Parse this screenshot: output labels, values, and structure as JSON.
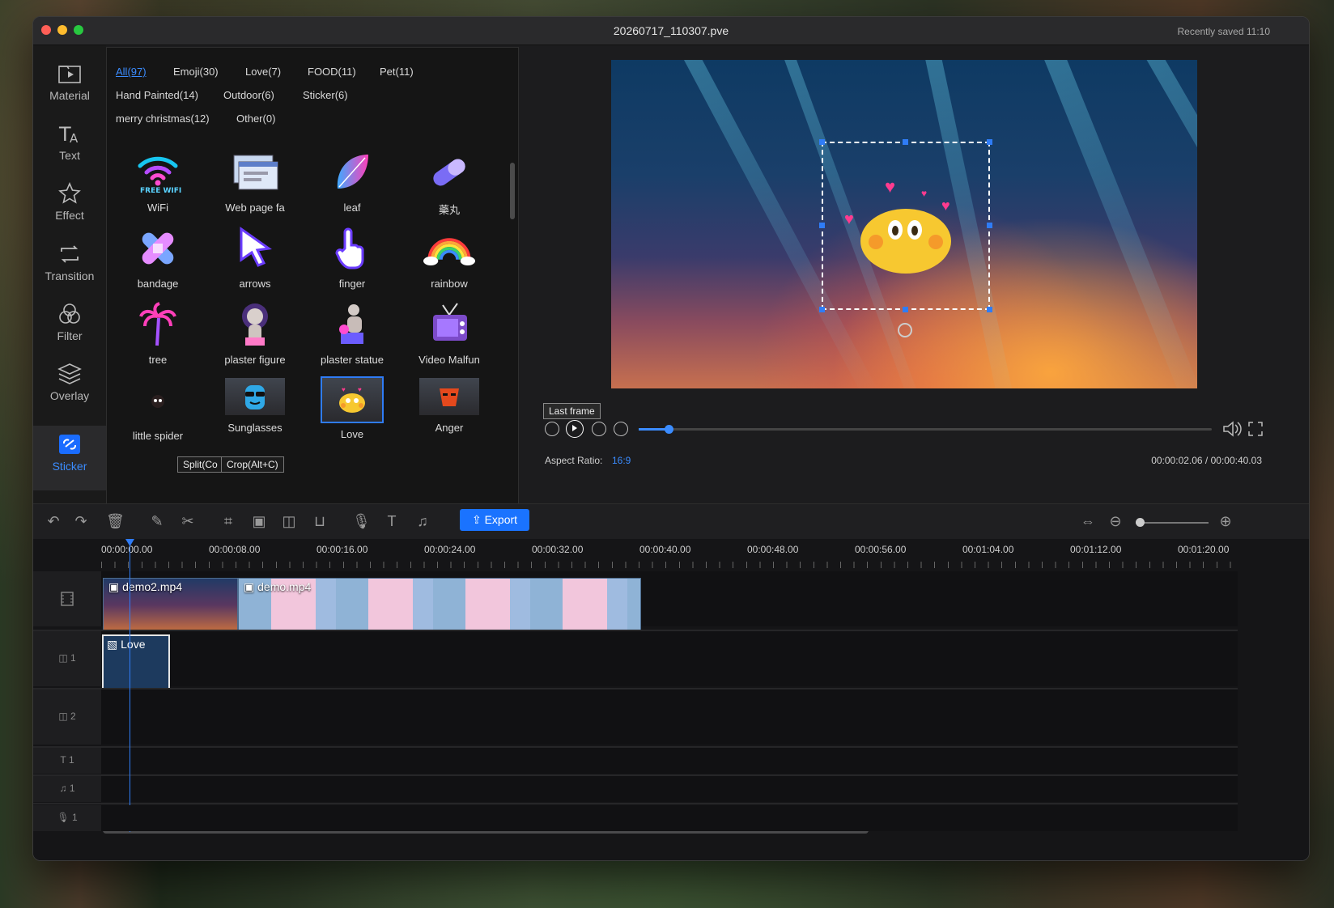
{
  "window": {
    "title": "20260717_110307.pve",
    "saved": "Recently saved  11:10"
  },
  "nav": [
    {
      "label": "Material",
      "icon": "folder-play-icon"
    },
    {
      "label": "Text",
      "icon": "text-icon"
    },
    {
      "label": "Effect",
      "icon": "star-effect-icon"
    },
    {
      "label": "Transition",
      "icon": "transition-icon"
    },
    {
      "label": "Filter",
      "icon": "filter-circles-icon"
    },
    {
      "label": "Overlay",
      "icon": "layers-icon"
    },
    {
      "label": "Sticker",
      "icon": "sticker-icon"
    }
  ],
  "categories": [
    "All(97)",
    "Emoji(30)",
    "Love(7)",
    "FOOD(11)",
    "Pet(11)",
    "Hand Painted(14)",
    "Outdoor(6)",
    "Sticker(6)",
    "merry christmas(12)",
    "Other(0)"
  ],
  "stickers": [
    {
      "label": "WiFi",
      "icon": "wifi-icon"
    },
    {
      "label": "Web page fa",
      "icon": "web-page-icon"
    },
    {
      "label": "leaf",
      "icon": "leaf-icon"
    },
    {
      "label": "藥丸",
      "icon": "pill-icon"
    },
    {
      "label": "bandage",
      "icon": "bandage-icon"
    },
    {
      "label": "arrows",
      "icon": "arrow-cursor-icon"
    },
    {
      "label": "finger",
      "icon": "hand-cursor-icon"
    },
    {
      "label": "rainbow",
      "icon": "rainbow-icon"
    },
    {
      "label": "tree",
      "icon": "palm-tree-icon"
    },
    {
      "label": "plaster figure",
      "icon": "plaster-figure-icon"
    },
    {
      "label": "plaster statue",
      "icon": "plaster-statue-icon"
    },
    {
      "label": "Video Malfun",
      "icon": "tv-icon"
    },
    {
      "label": "little spider",
      "icon": "spider-icon"
    },
    {
      "label": "Sunglasses",
      "icon": "sunglasses-icon"
    },
    {
      "label": "Love",
      "icon": "love-emoji-icon"
    },
    {
      "label": "Anger",
      "icon": "anger-icon"
    }
  ],
  "wifi_caption": "FREE WIFI",
  "tooltip": {
    "split": "Split(Co",
    "crop": "Crop(Alt+C)"
  },
  "preview": {
    "last_frame": "Last frame",
    "aspect_label": "Aspect Ratio:",
    "aspect_value": "16:9",
    "time": "00:00:02.06  /  00:00:40.03",
    "progress": 0.052
  },
  "toolbar": {
    "export": "Export"
  },
  "ruler": [
    "00:00:00.00",
    "00:00:08.00",
    "00:00:16.00",
    "00:00:24.00",
    "00:00:32.00",
    "00:00:40.00",
    "00:00:48.00",
    "00:00:56.00",
    "00:01:04.00",
    "00:01:12.00",
    "00:01:20.00"
  ],
  "tracks": {
    "clip1": "demo2.mp4",
    "clip2": "demo.mp4",
    "sticker_clip": "Love",
    "overlay1": "1",
    "overlay2": "2",
    "text1": "1",
    "music1": "1",
    "voice1": "1"
  }
}
